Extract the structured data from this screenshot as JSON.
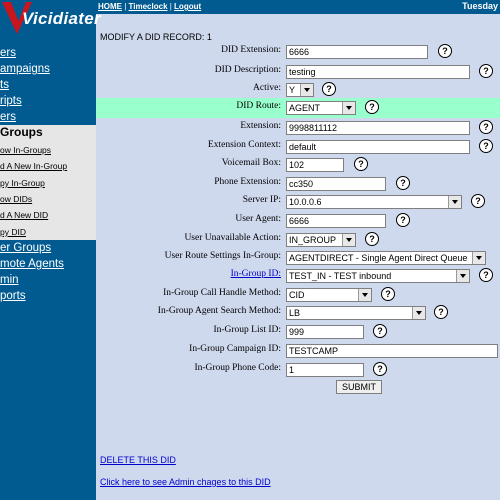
{
  "logo_text": "Vicidiater",
  "topbar": {
    "home": "HOME",
    "timeclock": "Timeclock",
    "logout": "Logout",
    "date": "Tuesday"
  },
  "sidebar": {
    "items": [
      "ers",
      "ampaigns",
      "ts",
      "ripts",
      "ers"
    ],
    "section": "Groups",
    "sub": [
      "ow In-Groups",
      "d A New In-Group",
      "py In-Group",
      "ow DIDs",
      "d A New DID",
      "py DID"
    ],
    "items2": [
      "er Groups",
      "mote Agents",
      "min",
      "ports"
    ]
  },
  "page_title": "MODIFY A DID RECORD: 1",
  "form": {
    "did_extension": {
      "label": "DID Extension:",
      "value": "6666"
    },
    "did_description": {
      "label": "DID Description:",
      "value": "testing"
    },
    "active": {
      "label": "Active:",
      "value": "Y"
    },
    "did_route": {
      "label": "DID Route:",
      "value": "AGENT"
    },
    "extension": {
      "label": "Extension:",
      "value": "9998811112"
    },
    "extension_context": {
      "label": "Extension Context:",
      "value": "default"
    },
    "voicemail_box": {
      "label": "Voicemail Box:",
      "value": "102"
    },
    "phone_extension": {
      "label": "Phone Extension:",
      "value": "cc350"
    },
    "server_ip": {
      "label": "Server IP:",
      "value": "10.0.0.6"
    },
    "user_agent": {
      "label": "User Agent:",
      "value": "6666"
    },
    "user_unavailable_action": {
      "label": "User Unavailable Action:",
      "value": "IN_GROUP"
    },
    "user_route_settings": {
      "label": "User Route Settings In-Group:",
      "value": "AGENTDIRECT - Single Agent Direct Queue"
    },
    "in_group_id": {
      "label": "In-Group ID:",
      "value": "TEST_IN - TEST inbound"
    },
    "call_handle_method": {
      "label": "In-Group Call Handle Method:",
      "value": "CID"
    },
    "agent_search_method": {
      "label": "In-Group Agent Search Method:",
      "value": "LB"
    },
    "list_id": {
      "label": "In-Group List ID:",
      "value": "999"
    },
    "campaign_id": {
      "label": "In-Group Campaign ID:",
      "value": "TESTCAMP"
    },
    "phone_code": {
      "label": "In-Group Phone Code:",
      "value": "1"
    },
    "submit": "SUBMIT"
  },
  "help_icon": "?",
  "delete_link": "DELETE THIS DID",
  "admin_changes_link": "Click here to see Admin chages to this DID"
}
